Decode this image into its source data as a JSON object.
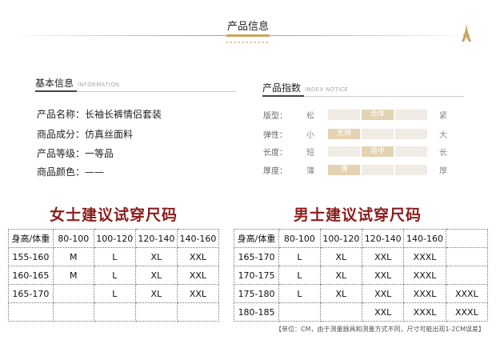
{
  "header": {
    "title": "产品信息"
  },
  "basic_info": {
    "title": "基本信息",
    "subtitle": "INFORMATION",
    "rows": [
      {
        "label": "产品名称：",
        "value": "长袖长裤情侣套装"
      },
      {
        "label": "商品成分：",
        "value": "仿真丝面料"
      },
      {
        "label": "产品等级：",
        "value": "一等品"
      },
      {
        "label": "商品颜色：",
        "value": "——"
      }
    ]
  },
  "index_notice": {
    "title": "产品指数",
    "subtitle": "INDEX NOTICE",
    "rows": [
      {
        "label": "版型：",
        "low": "松",
        "high": "紧",
        "selected": "合体",
        "level": 2
      },
      {
        "label": "弹性：",
        "low": "小",
        "high": "大",
        "selected": "无弹",
        "level": 1
      },
      {
        "label": "长度：",
        "low": "短",
        "high": "长",
        "selected": "适中",
        "level": 2
      },
      {
        "label": "厚度：",
        "low": "薄",
        "high": "厚",
        "selected": "薄",
        "level": 1
      }
    ]
  },
  "women_table": {
    "title": "女士建议试穿尺码",
    "headers": [
      "身高/体重",
      "80-100",
      "100-120",
      "120-140",
      "140-160"
    ],
    "rows": [
      [
        "155-160",
        "M",
        "L",
        "XL",
        "XXL"
      ],
      [
        "160-165",
        "M",
        "L",
        "XL",
        "XXL"
      ],
      [
        "165-170",
        "",
        "L",
        "XL",
        "XXL"
      ],
      [
        "",
        "",
        "",
        "",
        ""
      ]
    ]
  },
  "men_table": {
    "title": "男士建议试穿尺码",
    "headers": [
      "身高/体重",
      "80-100",
      "100-120",
      "120-140",
      "140-160",
      ""
    ],
    "rows": [
      [
        "165-170",
        "L",
        "XL",
        "XXL",
        "XXXL",
        ""
      ],
      [
        "170-175",
        "L",
        "XL",
        "XXL",
        "XXXL",
        ""
      ],
      [
        "175-180",
        "L",
        "XL",
        "XXL",
        "XXXL",
        "XXXL"
      ],
      [
        "180-185",
        "",
        "",
        "XXL",
        "XXXL",
        "XXXL"
      ]
    ]
  },
  "footnote": "【单位：CM，由于测量器具和测量方式不同，尺寸可能出现1-2CM误差】",
  "colors": {
    "accent": "#c9a55c",
    "title_red": "#8c1d1d",
    "bar_bg": "#f0ebe4",
    "bar_sel": "#e3d3b2"
  }
}
